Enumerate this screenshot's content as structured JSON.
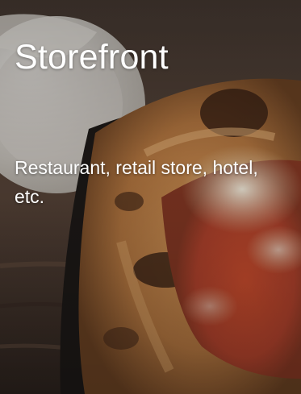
{
  "card": {
    "title": "Storefront",
    "subtitle": "Restaurant, retail store, hotel, etc.",
    "image": "pizza-photo"
  },
  "colors": {
    "text": "#ffffff",
    "background": "#3a2f29"
  }
}
